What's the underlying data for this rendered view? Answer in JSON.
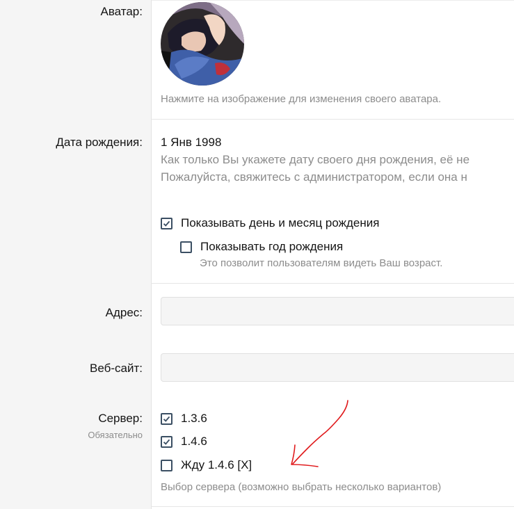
{
  "avatar": {
    "label": "Аватар:",
    "hint": "Нажмите на изображение для изменения своего аватара."
  },
  "birthday": {
    "label": "Дата рождения:",
    "value": "1 Янв 1998",
    "explain_line1": "Как только Вы укажете дату своего дня рождения, её не",
    "explain_line2": "Пожалуйста, свяжитесь с администратором, если она н",
    "show_day_month": {
      "label": "Показывать день и месяц рождения",
      "checked": true
    },
    "show_year": {
      "label": "Показывать год рождения",
      "checked": false
    },
    "show_year_hint": "Это позволит пользователям видеть Ваш возраст."
  },
  "address": {
    "label": "Адрес:",
    "value": ""
  },
  "website": {
    "label": "Веб-сайт:",
    "value": ""
  },
  "server": {
    "label": "Сервер:",
    "required": "Обязательно",
    "options": [
      {
        "label": "1.3.6",
        "checked": true
      },
      {
        "label": "1.4.6",
        "checked": true
      },
      {
        "label": "Жду 1.4.6 [X]",
        "checked": false
      }
    ],
    "hint": "Выбор сервера (возможно выбрать несколько вариантов)"
  },
  "colors": {
    "label_bg": "#f5f5f5",
    "checkbox_border": "#3b4f63",
    "muted_text": "#8c8c8c",
    "annotation_arrow": "#e0191b"
  }
}
